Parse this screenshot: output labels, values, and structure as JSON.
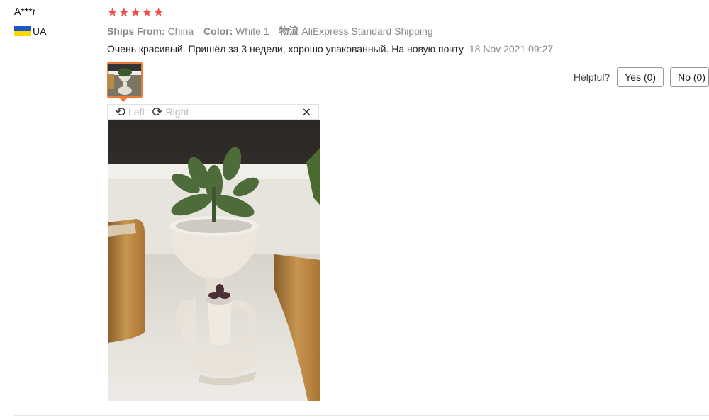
{
  "review": {
    "user_name": "A***r",
    "country_code": "UA",
    "rating": 5,
    "ships_from_label": "Ships From:",
    "ships_from_value": "China",
    "color_label": "Color:",
    "color_value": "White 1",
    "shipping_label": "物流",
    "shipping_value": "AliExpress Standard Shipping",
    "text": "Очень красивый. Пришёл за 3 недели, хорошо упакованный. На новую почту",
    "date": "18 Nov 2021 09:27"
  },
  "helpful": {
    "label": "Helpful?",
    "yes_label": "Yes (0)",
    "no_label": "No (0)"
  },
  "viewer": {
    "rotate_left_label": "Left",
    "rotate_right_label": "Right",
    "close_icon": "✕"
  },
  "colors": {
    "star": "#f24a4a",
    "thumb_border": "#ee7a35"
  }
}
